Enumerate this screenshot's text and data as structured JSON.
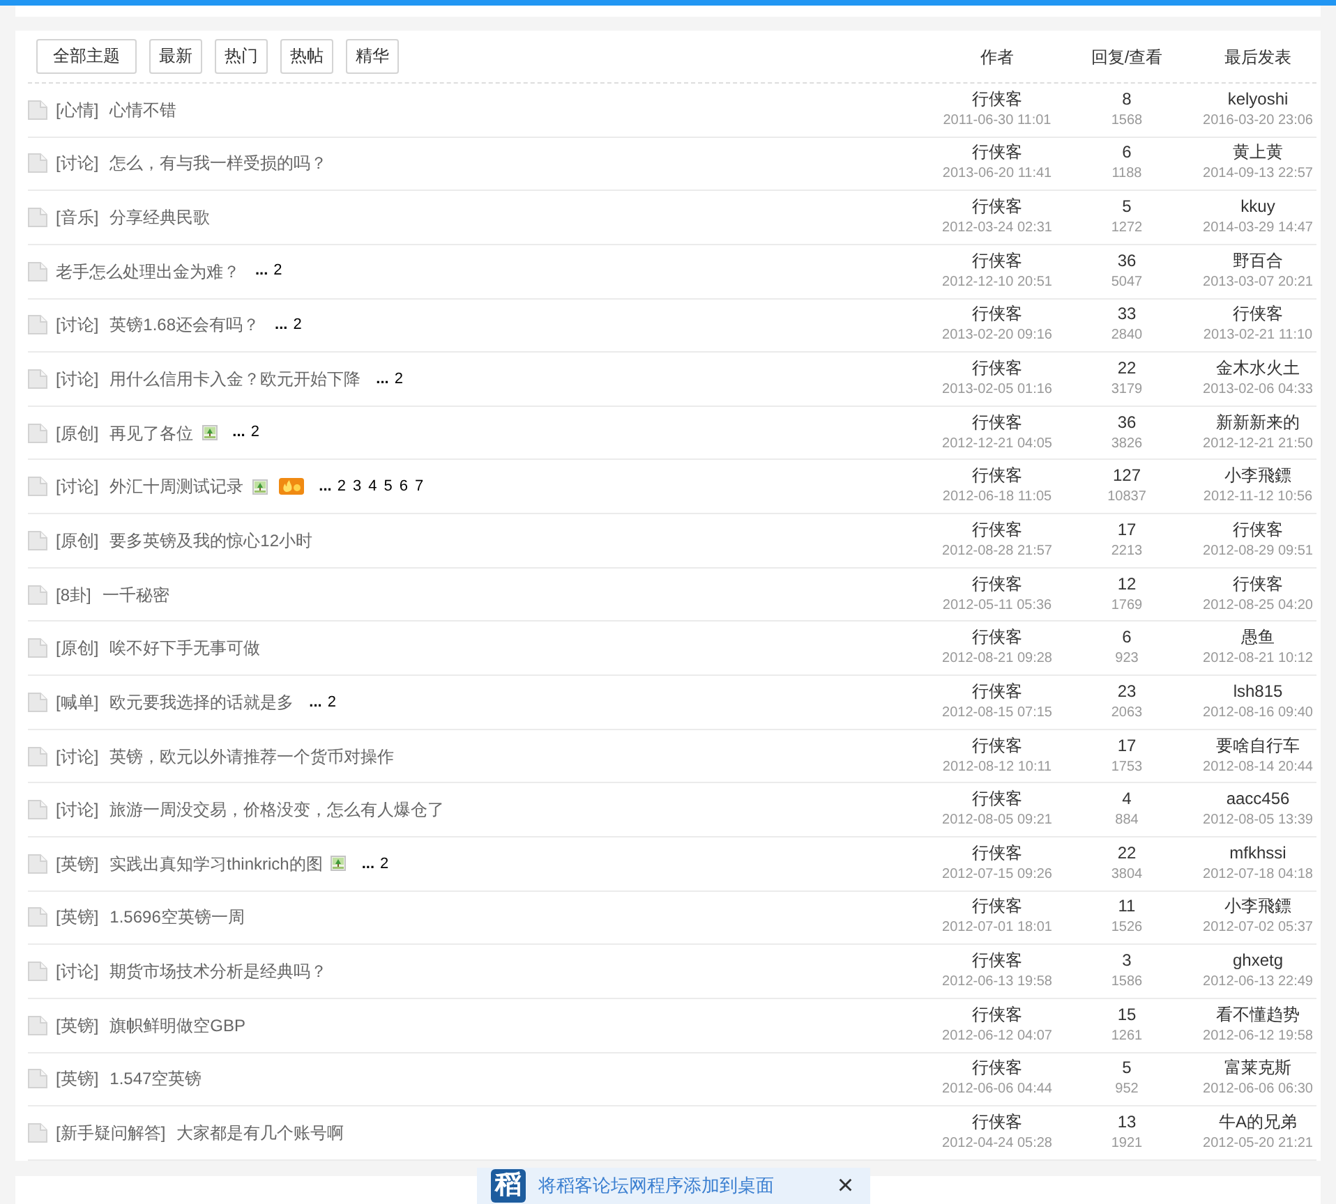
{
  "filter_buttons": [
    "全部主题",
    "最新",
    "热门",
    "热帖",
    "精华"
  ],
  "columns": [
    "作者",
    "回复/查看",
    "最后发表"
  ],
  "threads": [
    {
      "category": "[心情]",
      "title": "心情不错",
      "image": false,
      "hot": false,
      "author": "行侠客",
      "posted": "2011-06-30 11:01",
      "replies": "8",
      "views": "1568",
      "last_poster": "kelyoshi",
      "last_post_time": "2016-03-20 23:06"
    },
    {
      "category": "[讨论]",
      "title": "怎么，有与我一样受损的吗？",
      "image": false,
      "hot": false,
      "author": "行侠客",
      "posted": "2013-06-20 11:41",
      "replies": "6",
      "views": "1188",
      "last_poster": "黄上黄",
      "last_post_time": "2014-09-13 22:57"
    },
    {
      "category": "[音乐]",
      "title": "分享经典民歌",
      "image": false,
      "hot": false,
      "author": "行侠客",
      "posted": "2012-03-24 02:31",
      "replies": "5",
      "views": "1272",
      "last_poster": "kkuy",
      "last_post_time": "2014-03-29 14:47"
    },
    {
      "title": "老手怎么处理出金为难？",
      "image": false,
      "hot": false,
      "pages": {
        "ellipsis": "...",
        "numbers": [
          "2"
        ]
      },
      "author": "行侠客",
      "posted": "2012-12-10 20:51",
      "replies": "36",
      "views": "5047",
      "last_poster": "野百合",
      "last_post_time": "2013-03-07 20:21"
    },
    {
      "category": "[讨论]",
      "title": "英镑1.68还会有吗？",
      "image": false,
      "hot": false,
      "pages": {
        "ellipsis": "...",
        "numbers": [
          "2"
        ]
      },
      "author": "行侠客",
      "posted": "2013-02-20 09:16",
      "replies": "33",
      "views": "2840",
      "last_poster": "行侠客",
      "last_post_time": "2013-02-21 11:10"
    },
    {
      "category": "[讨论]",
      "title": "用什么信用卡入金？欧元开始下降",
      "image": false,
      "hot": false,
      "pages": {
        "ellipsis": "...",
        "numbers": [
          "2"
        ]
      },
      "author": "行侠客",
      "posted": "2013-02-05 01:16",
      "replies": "22",
      "views": "3179",
      "last_poster": "金木水火土",
      "last_post_time": "2013-02-06 04:33"
    },
    {
      "category": "[原创]",
      "title": "再见了各位",
      "image": true,
      "hot": false,
      "pages": {
        "ellipsis": "...",
        "numbers": [
          "2"
        ]
      },
      "author": "行侠客",
      "posted": "2012-12-21 04:05",
      "replies": "36",
      "views": "3826",
      "last_poster": "新新新来的",
      "last_post_time": "2012-12-21 21:50"
    },
    {
      "category": "[讨论]",
      "title": "外汇十周测试记录",
      "image": true,
      "hot": true,
      "pages": {
        "ellipsis": "...",
        "numbers": [
          "2",
          "3",
          "4",
          "5",
          "6",
          "7"
        ]
      },
      "author": "行侠客",
      "posted": "2012-06-18 11:05",
      "replies": "127",
      "views": "10837",
      "last_poster": "小李飛鏢",
      "last_post_time": "2012-11-12 10:56"
    },
    {
      "category": "[原创]",
      "title": "要多英镑及我的惊心12小时",
      "image": false,
      "hot": false,
      "author": "行侠客",
      "posted": "2012-08-28 21:57",
      "replies": "17",
      "views": "2213",
      "last_poster": "行侠客",
      "last_post_time": "2012-08-29 09:51"
    },
    {
      "category": "[8卦]",
      "title": "一千秘密",
      "image": false,
      "hot": false,
      "author": "行侠客",
      "posted": "2012-05-11 05:36",
      "replies": "12",
      "views": "1769",
      "last_poster": "行侠客",
      "last_post_time": "2012-08-25 04:20"
    },
    {
      "category": "[原创]",
      "title": "唉不好下手无事可做",
      "image": false,
      "hot": false,
      "author": "行侠客",
      "posted": "2012-08-21 09:28",
      "replies": "6",
      "views": "923",
      "last_poster": "愚鱼",
      "last_post_time": "2012-08-21 10:12"
    },
    {
      "category": "[喊单]",
      "title": "欧元要我选择的话就是多",
      "image": false,
      "hot": false,
      "pages": {
        "ellipsis": "...",
        "numbers": [
          "2"
        ]
      },
      "author": "行侠客",
      "posted": "2012-08-15 07:15",
      "replies": "23",
      "views": "2063",
      "last_poster": "lsh815",
      "last_post_time": "2012-08-16 09:40"
    },
    {
      "category": "[讨论]",
      "title": "英镑，欧元以外请推荐一个货币对操作",
      "image": false,
      "hot": false,
      "author": "行侠客",
      "posted": "2012-08-12 10:11",
      "replies": "17",
      "views": "1753",
      "last_poster": "要啥自行车",
      "last_post_time": "2012-08-14 20:44"
    },
    {
      "category": "[讨论]",
      "title": "旅游一周没交易，价格没变，怎么有人爆仓了",
      "image": false,
      "hot": false,
      "author": "行侠客",
      "posted": "2012-08-05 09:21",
      "replies": "4",
      "views": "884",
      "last_poster": "aacc456",
      "last_post_time": "2012-08-05 13:39"
    },
    {
      "category": "[英镑]",
      "title": "实践出真知学习thinkrich的图",
      "image": true,
      "hot": false,
      "pages": {
        "ellipsis": "...",
        "numbers": [
          "2"
        ]
      },
      "author": "行侠客",
      "posted": "2012-07-15 09:26",
      "replies": "22",
      "views": "3804",
      "last_poster": "mfkhssi",
      "last_post_time": "2012-07-18 04:18"
    },
    {
      "category": "[英镑]",
      "title": "1.5696空英镑一周",
      "image": false,
      "hot": false,
      "author": "行侠客",
      "posted": "2012-07-01 18:01",
      "replies": "11",
      "views": "1526",
      "last_poster": "小李飛鏢",
      "last_post_time": "2012-07-02 05:37"
    },
    {
      "category": "[讨论]",
      "title": "期货市场技术分析是经典吗？",
      "image": false,
      "hot": false,
      "author": "行侠客",
      "posted": "2012-06-13 19:58",
      "replies": "3",
      "views": "1586",
      "last_poster": "ghxetg",
      "last_post_time": "2012-06-13 22:49"
    },
    {
      "category": "[英镑]",
      "title": "旗帜鲜明做空GBP",
      "image": false,
      "hot": false,
      "author": "行侠客",
      "posted": "2012-06-12 04:07",
      "replies": "15",
      "views": "1261",
      "last_poster": "看不懂趋势",
      "last_post_time": "2012-06-12 19:58"
    },
    {
      "category": "[英镑]",
      "title": "1.547空英镑",
      "image": false,
      "hot": false,
      "author": "行侠客",
      "posted": "2012-06-06 04:44",
      "replies": "5",
      "views": "952",
      "last_poster": "富莱克斯",
      "last_post_time": "2012-06-06 06:30"
    },
    {
      "category": "[新手疑问解答]",
      "title": "大家都是有几个账号啊",
      "image": false,
      "hot": false,
      "author": "行侠客",
      "posted": "2012-04-24 05:28",
      "replies": "13",
      "views": "1921",
      "last_poster": "牛A的兄弟",
      "last_post_time": "2012-05-20 21:21"
    }
  ],
  "banner": {
    "logo": "稻",
    "text": "将稻客论坛网程序添加到桌面",
    "close": "×"
  }
}
